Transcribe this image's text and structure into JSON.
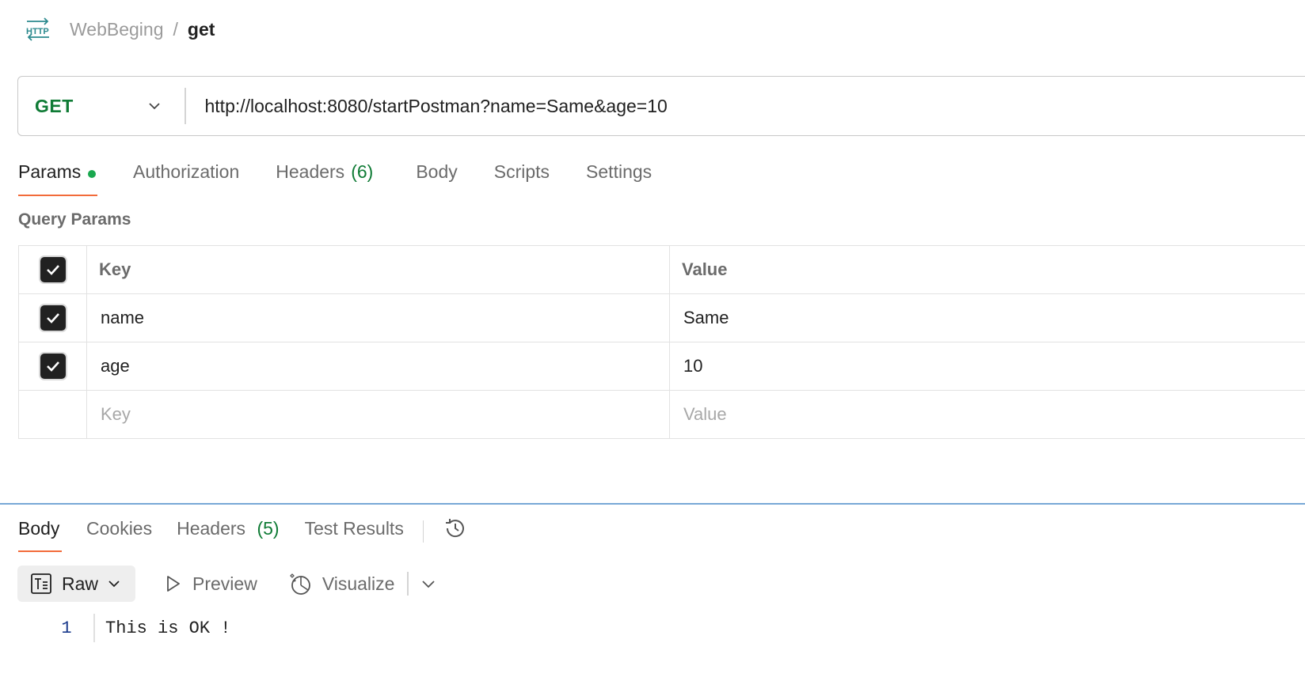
{
  "breadcrumb": {
    "icon": "http-icon",
    "parent": "WebBeging",
    "separator": "/",
    "current": "get"
  },
  "request": {
    "method": "GET",
    "method_color": "#0f7b35",
    "url": "http://localhost:8080/startPostman?name=Same&age=10"
  },
  "request_tabs": [
    {
      "label": "Params",
      "active": true,
      "dot": true
    },
    {
      "label": "Authorization"
    },
    {
      "label": "Headers",
      "count": "(6)"
    },
    {
      "label": "Body"
    },
    {
      "label": "Scripts"
    },
    {
      "label": "Settings"
    }
  ],
  "query_params": {
    "title": "Query Params",
    "columns": {
      "key": "Key",
      "value": "Value"
    },
    "rows": [
      {
        "checked": true,
        "key": "name",
        "value": "Same"
      },
      {
        "checked": true,
        "key": "age",
        "value": "10"
      }
    ],
    "new_row": {
      "key_placeholder": "Key",
      "value_placeholder": "Value"
    }
  },
  "response_tabs": [
    {
      "label": "Body",
      "active": true
    },
    {
      "label": "Cookies"
    },
    {
      "label": "Headers",
      "count": "(5)"
    },
    {
      "label": "Test Results"
    }
  ],
  "response_view": {
    "format": "Raw",
    "preview": "Preview",
    "visualize": "Visualize"
  },
  "response_body": [
    {
      "line": "1",
      "text": "This is OK !"
    }
  ],
  "colors": {
    "accent": "#f26b3a",
    "success": "#0f7b35",
    "status_dot": "#1aa84f"
  }
}
